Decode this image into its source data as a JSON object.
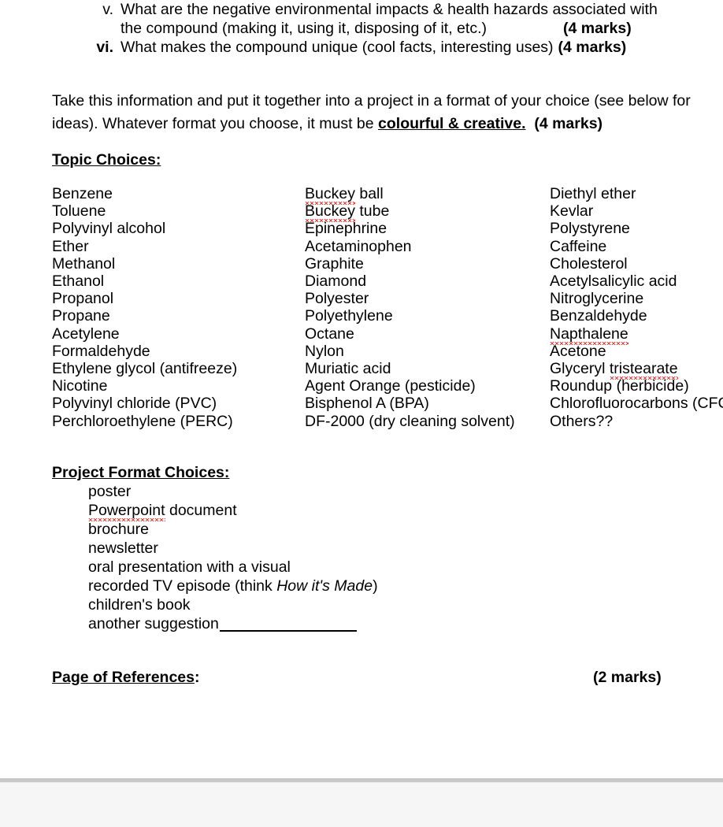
{
  "document": {
    "roman_list": [
      {
        "marker": "v.",
        "marker_bold": false,
        "line1": "What are the negative environmental impacts & health hazards associated with",
        "line2": "the compound (making it, using it, disposing of it, etc.)",
        "marks": "(4 marks)"
      },
      {
        "marker": "vi.",
        "marker_bold": true,
        "line1": "What makes the compound unique (cool facts, interesting uses)",
        "line2": "",
        "marks": "(4 marks)"
      }
    ],
    "paragraph": {
      "part1": "Take this information and put it together into a project in a format of your choice (see below for ideas).  Whatever format you choose, it must be ",
      "emphasis": "colourful & creative.",
      "marks": "(4 marks)"
    },
    "topic_choices": {
      "heading": "Topic Choices:",
      "columns": [
        {
          "items": [
            {
              "text": "Benzene",
              "misspelled": false
            },
            {
              "text": "Toluene",
              "misspelled": false
            },
            {
              "text": "Polyvinyl alcohol",
              "misspelled": false
            },
            {
              "text": "Ether",
              "misspelled": false
            },
            {
              "text": "Methanol",
              "misspelled": false
            },
            {
              "text": "Ethanol",
              "misspelled": false
            },
            {
              "text": "Propanol",
              "misspelled": false
            },
            {
              "text": "Propane",
              "misspelled": false
            },
            {
              "text": "Acetylene",
              "misspelled": false
            },
            {
              "text": "Formaldehyde",
              "misspelled": false
            },
            {
              "text": "Ethylene glycol (antifreeze)",
              "misspelled": false
            },
            {
              "text": "Nicotine",
              "misspelled": false
            },
            {
              "text": "Polyvinyl chloride (PVC)",
              "misspelled": false
            },
            {
              "text": "Perchloroethylene (PERC)",
              "misspelled": false
            }
          ]
        },
        {
          "items": [
            {
              "text": "Buckey ball",
              "misspelled": true,
              "misspelled_word": "Buckey",
              "rest": " ball"
            },
            {
              "text": "Buckey tube",
              "misspelled": true,
              "misspelled_word": "Buckey",
              "rest": " tube"
            },
            {
              "text": "Epinephrine",
              "misspelled": false
            },
            {
              "text": "Acetaminophen",
              "misspelled": false
            },
            {
              "text": "Graphite",
              "misspelled": false
            },
            {
              "text": "Diamond",
              "misspelled": false
            },
            {
              "text": "Polyester",
              "misspelled": false
            },
            {
              "text": "Polyethylene",
              "misspelled": false
            },
            {
              "text": "Octane",
              "misspelled": false
            },
            {
              "text": "Nylon",
              "misspelled": false
            },
            {
              "text": "Muriatic acid",
              "misspelled": false
            },
            {
              "text": "Agent Orange (pesticide)",
              "misspelled": false
            },
            {
              "text": "Bisphenol A (BPA)",
              "misspelled": false
            },
            {
              "text": "DF-2000 (dry cleaning solvent)",
              "misspelled": false
            }
          ]
        },
        {
          "items": [
            {
              "text": "Diethyl ether",
              "misspelled": false
            },
            {
              "text": "Kevlar",
              "misspelled": false
            },
            {
              "text": "Polystyrene",
              "misspelled": false
            },
            {
              "text": "Caffeine",
              "misspelled": false
            },
            {
              "text": "Cholesterol",
              "misspelled": false
            },
            {
              "text": "Acetylsalicylic acid",
              "misspelled": false
            },
            {
              "text": "Nitroglycerine",
              "misspelled": false
            },
            {
              "text": "Benzaldehyde",
              "misspelled": false
            },
            {
              "text": "Napthalene",
              "misspelled": true,
              "misspelled_word": "Napthalene",
              "rest": ""
            },
            {
              "text": "Acetone",
              "misspelled": false
            },
            {
              "text": "Glyceryl tristearate",
              "misspelled": true,
              "prefix": "Glyceryl ",
              "misspelled_word": "tristearate",
              "rest": ""
            },
            {
              "text": "Roundup (herbicide)",
              "misspelled": false
            },
            {
              "text": "Chlorofluorocarbons (CFC",
              "misspelled": false
            },
            {
              "text": "Others??",
              "misspelled": false
            }
          ]
        }
      ]
    },
    "project_format": {
      "heading": "Project Format Choices:",
      "items": [
        {
          "text": "poster"
        },
        {
          "text": "Powerpoint document",
          "misspelled": true,
          "misspelled_word": "Powerpoint",
          "rest": " document"
        },
        {
          "text": "brochure"
        },
        {
          "text": "newsletter"
        },
        {
          "text": "oral presentation with a visual"
        },
        {
          "text": "recorded TV episode (think ",
          "italic": "How it's Made",
          "suffix": ")"
        },
        {
          "text": "children's book"
        },
        {
          "text": "another suggestion",
          "has_blank": true
        }
      ]
    },
    "references": {
      "heading": "Page of References",
      "colon": ":",
      "marks": "(2 marks)"
    }
  },
  "colors": {
    "page_background": "#ffffff",
    "app_background": "#f6f6f6",
    "page_divider": "#c8c8c8",
    "text": "#000000",
    "spellcheck_underline": "#d04a4a"
  }
}
